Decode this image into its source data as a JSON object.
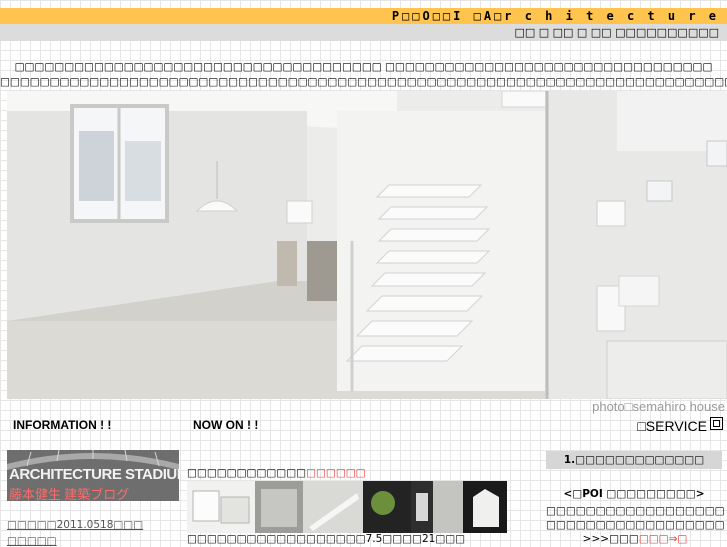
{
  "header": {
    "title": "P□□O□□I  □A□r c h i t e c t u r e",
    "subtitle": "□□ □ □□ □ □□ □□□□□□□□□□"
  },
  "intro": {
    "line1": "□□□□□□□□□□□□□□□□□□□□□□□□□□□□□□□□□□□□□ □□□□□□□□□□□□□□□□□□□□□□□□□□□□□□□□□",
    "line2": "□□□□□□□□□□□□□□□□□□□□□□□□□□□□□□□□□□□□□□□□□□□□□□□□□□□□□□□□□□□□□□□□□□□□□□□□□□"
  },
  "hero": {
    "credit": "photo□semahiro house"
  },
  "sections": {
    "information": "INFORMATION ! !",
    "now_on": "NOW ON  ! !",
    "service": "□SERVICE"
  },
  "information": {
    "banner_title": "ARCHITECTURE STADIUM",
    "banner_subtitle": "藤本健生  建築ブログ",
    "link": "□□□□□2011.0518□□□",
    "link2": "□□□□□"
  },
  "now_on": {
    "title": "□□□□□□□□□□□□",
    "title_highlight": "□□□□□□",
    "caption": "□□□□□□□□□□□□□□□□□□7.5□□□□21□□□"
  },
  "service": {
    "button": "1.□□□□□□□□□□□□□",
    "title": "<□POI □□□□□□□□□>",
    "line1": "□□□□□□□□□□□□□□□□□□□□ □□",
    "line2": "□□□□□□□□□□□□□□□□□□□□□□□",
    "line3_prefix": ">>>□□□",
    "line3_link": "□□□⇒□"
  }
}
